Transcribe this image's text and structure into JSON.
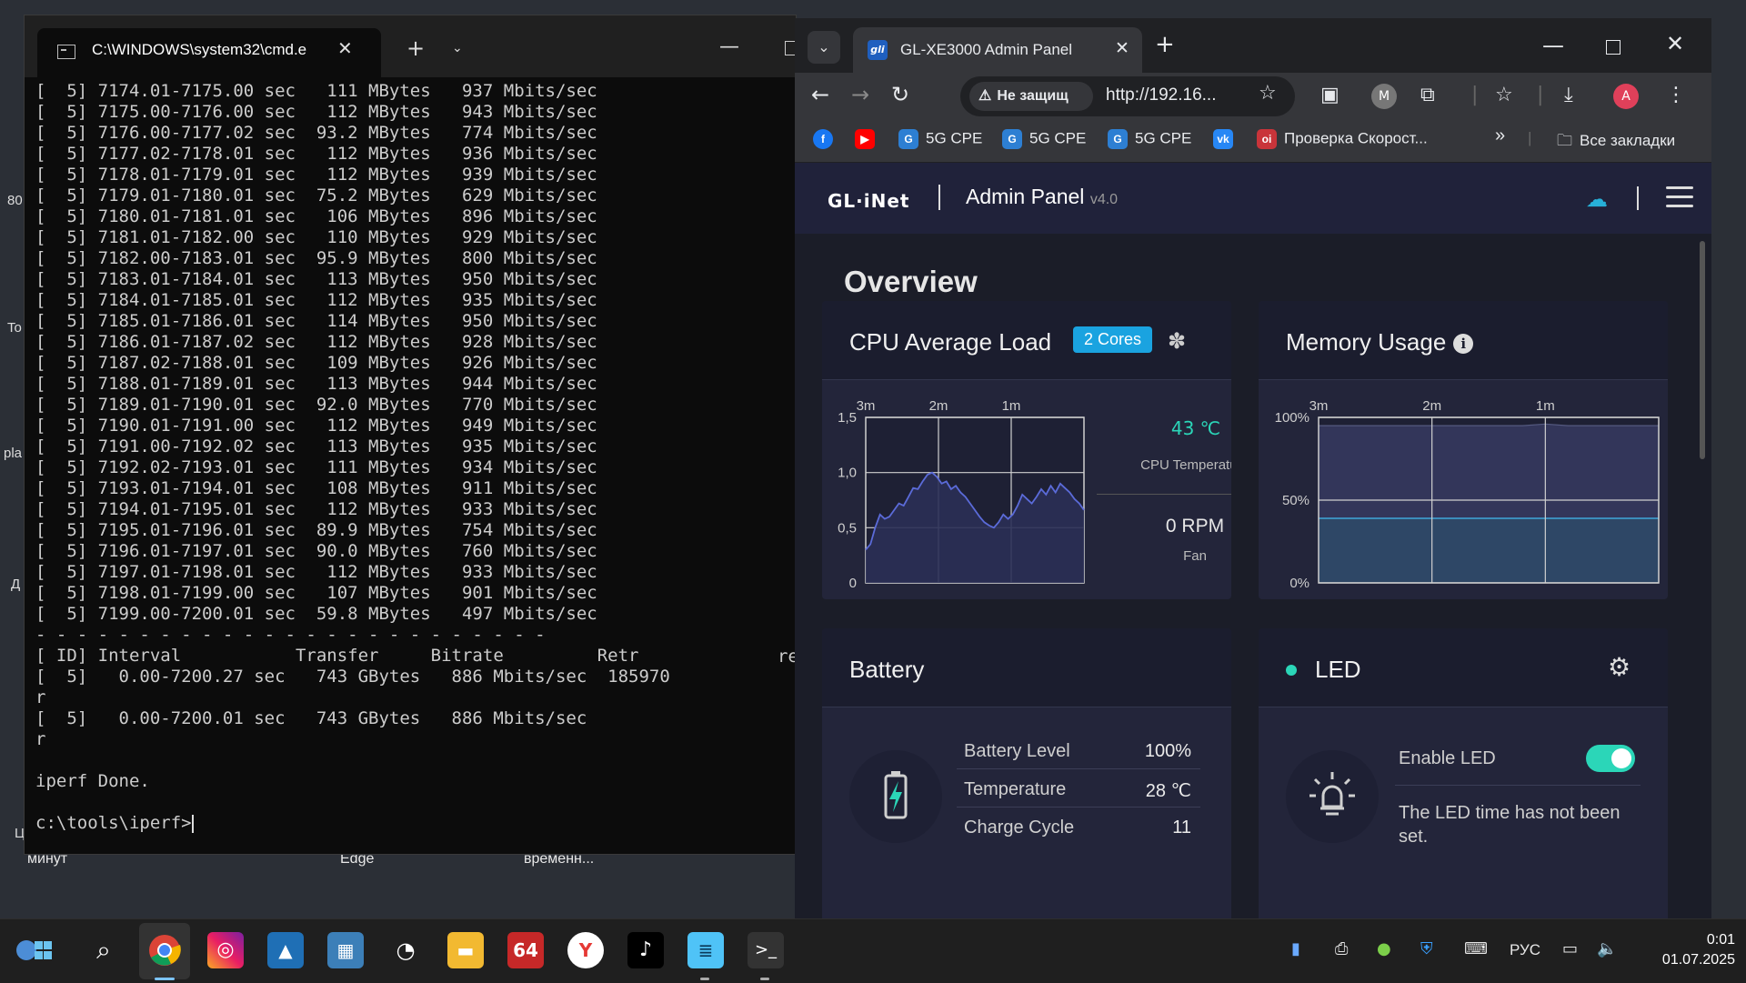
{
  "desktop": {
    "edge_labels": [
      "80",
      "To",
      "pla",
      "Д",
      "Ц"
    ],
    "bottom_labels": [
      "минут",
      "Edge",
      "временн..."
    ]
  },
  "terminal": {
    "tab_title": "C:\\WINDOWS\\system32\\cmd.e",
    "lines": [
      "[  5] 7174.01-7175.00 sec   111 MBytes   937 Mbits/sec",
      "[  5] 7175.00-7176.00 sec   112 MBytes   943 Mbits/sec",
      "[  5] 7176.00-7177.02 sec  93.2 MBytes   774 Mbits/sec",
      "[  5] 7177.02-7178.01 sec   112 MBytes   936 Mbits/sec",
      "[  5] 7178.01-7179.01 sec   112 MBytes   939 Mbits/sec",
      "[  5] 7179.01-7180.01 sec  75.2 MBytes   629 Mbits/sec",
      "[  5] 7180.01-7181.01 sec   106 MBytes   896 Mbits/sec",
      "[  5] 7181.01-7182.00 sec   110 MBytes   929 Mbits/sec",
      "[  5] 7182.00-7183.01 sec  95.9 MBytes   800 Mbits/sec",
      "[  5] 7183.01-7184.01 sec   113 MBytes   950 Mbits/sec",
      "[  5] 7184.01-7185.01 sec   112 MBytes   935 Mbits/sec",
      "[  5] 7185.01-7186.01 sec   114 MBytes   950 Mbits/sec",
      "[  5] 7186.01-7187.02 sec   112 MBytes   928 Mbits/sec",
      "[  5] 7187.02-7188.01 sec   109 MBytes   926 Mbits/sec",
      "[  5] 7188.01-7189.01 sec   113 MBytes   944 Mbits/sec",
      "[  5] 7189.01-7190.01 sec  92.0 MBytes   770 Mbits/sec",
      "[  5] 7190.01-7191.00 sec   112 MBytes   949 Mbits/sec",
      "[  5] 7191.00-7192.02 sec   113 MBytes   935 Mbits/sec",
      "[  5] 7192.02-7193.01 sec   111 MBytes   934 Mbits/sec",
      "[  5] 7193.01-7194.01 sec   108 MBytes   911 Mbits/sec",
      "[  5] 7194.01-7195.01 sec   112 MBytes   933 Mbits/sec",
      "[  5] 7195.01-7196.01 sec  89.9 MBytes   754 Mbits/sec",
      "[  5] 7196.01-7197.01 sec  90.0 MBytes   760 Mbits/sec",
      "[  5] 7197.01-7198.01 sec   112 MBytes   933 Mbits/sec",
      "[  5] 7198.01-7199.00 sec   107 MBytes   901 Mbits/sec",
      "[  5] 7199.00-7200.01 sec  59.8 MBytes   497 Mbits/sec",
      "- - - - - - - - - - - - - - - - - - - - - - - - -",
      "[ ID] Interval           Transfer     Bitrate         Retr",
      "[  5]   0.00-7200.27 sec   743 GBytes   886 Mbits/sec  185970",
      "r",
      "[  5]   0.00-7200.01 sec   743 GBytes   886 Mbits/sec",
      "r",
      "",
      "iperf Done.",
      "",
      "c:\\tools\\iperf>"
    ],
    "trailing_text": "re"
  },
  "browser": {
    "tab_title": "GL-XE3000 Admin Panel",
    "tab_favicon": "gli",
    "security_label": "Не защищ",
    "url": "http://192.16...",
    "profile_letter": "A",
    "extension_letter": "M",
    "bookmarks": [
      {
        "label": "",
        "icon": "facebook-icon",
        "color": "#1877f2"
      },
      {
        "label": "",
        "icon": "youtube-icon",
        "color": "#ff0000"
      },
      {
        "label": "5G CPE",
        "icon": "gl-icon",
        "color": "#2d7fd3"
      },
      {
        "label": "5G CPE",
        "icon": "gl-icon",
        "color": "#2d7fd3"
      },
      {
        "label": "5G CPE",
        "icon": "gl-icon",
        "color": "#2d7fd3"
      },
      {
        "label": "",
        "icon": "vk-icon",
        "color": "#2787f5"
      },
      {
        "label": "Проверка Скорост...",
        "icon": "speedtest-icon",
        "color": "#c9343a"
      }
    ],
    "bookmarks_overflow": "»",
    "all_bookmarks": "Все закладки"
  },
  "admin": {
    "logo": "GL·iNet",
    "title": "Admin Panel",
    "version": "v4.0",
    "overview": "Overview",
    "cpu": {
      "title": "CPU Average Load",
      "cores": "2 Cores",
      "temperature": "43 ℃",
      "temperature_label": "CPU Temperature",
      "fan_speed": "0 RPM",
      "fan_label": "Fan"
    },
    "memory": {
      "title": "Memory Usage"
    },
    "battery": {
      "title": "Battery",
      "rows": [
        {
          "label": "Battery Level",
          "value": "100%"
        },
        {
          "label": "Temperature",
          "value": "28 ℃"
        },
        {
          "label": "Charge Cycle",
          "value": "11"
        }
      ]
    },
    "led": {
      "title": "LED",
      "enable_label": "Enable LED",
      "enabled": true,
      "note": "The LED time has not been set."
    },
    "accent_color": "#2bd6b8",
    "badge_color": "#1aa3e0"
  },
  "chart_data": [
    {
      "type": "line",
      "title": "",
      "x_ticks": [
        "3m",
        "2m",
        "1m"
      ],
      "y_ticks": [
        "1,5",
        "1,0",
        "0,5",
        "0"
      ],
      "ylim": [
        0,
        1.5
      ],
      "series": [
        {
          "values": [
            0.3,
            0.35,
            0.5,
            0.62,
            0.58,
            0.6,
            0.66,
            0.72,
            0.7,
            0.78,
            0.86,
            0.85,
            0.92,
            0.98,
            1.0,
            0.96,
            0.9,
            0.92,
            0.85,
            0.88,
            0.82,
            0.78,
            0.72,
            0.66,
            0.6,
            0.55,
            0.52,
            0.5,
            0.55,
            0.62,
            0.58,
            0.62,
            0.7,
            0.8,
            0.76,
            0.72,
            0.78,
            0.85,
            0.8,
            0.88,
            0.82,
            0.9,
            0.86,
            0.82,
            0.76,
            0.72,
            0.66
          ]
        }
      ]
    },
    {
      "type": "area",
      "title": "",
      "x_ticks": [
        "3m",
        "2m",
        "1m"
      ],
      "y_ticks": [
        "100%",
        "50%",
        "0%"
      ],
      "ylim": [
        0,
        100
      ],
      "series": [
        {
          "values": [
            95,
            95,
            95,
            95,
            95,
            95,
            95,
            95,
            95,
            95,
            96,
            95,
            95,
            95,
            95,
            95
          ]
        },
        {
          "values": [
            39,
            39,
            39,
            39,
            39,
            39,
            39,
            39,
            39,
            39,
            39,
            39,
            39,
            39,
            39,
            39
          ]
        }
      ]
    }
  ],
  "taskbar": {
    "language": "РУС",
    "time": "0:01",
    "date": "01.07.2025"
  }
}
